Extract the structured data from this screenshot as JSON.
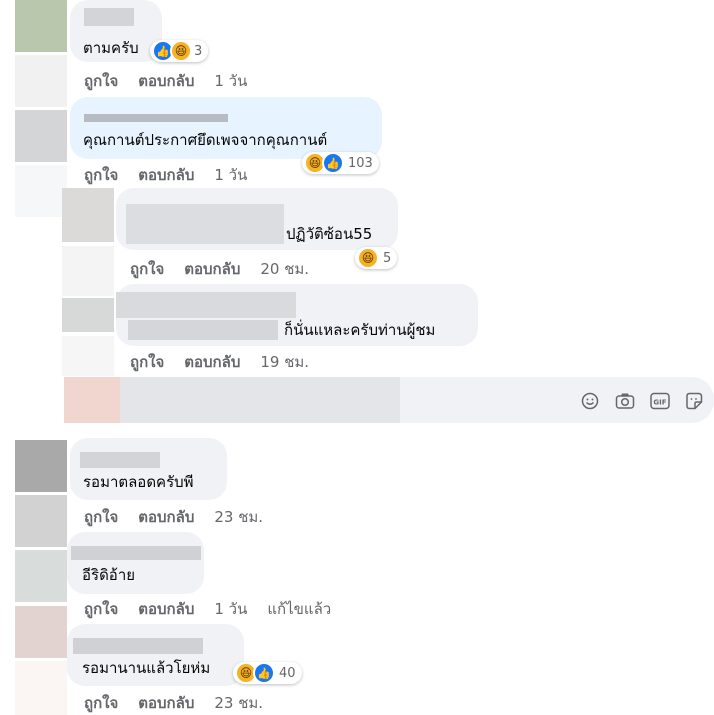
{
  "actions": {
    "like": "ถูกใจ",
    "reply": "ตอบกลับ",
    "edited": "แก้ไขแล้ว"
  },
  "comments": [
    {
      "text": "ตามครับ",
      "reactions": "3",
      "time": "1 วัน"
    },
    {
      "text": "คุณกานต์ประกาศยึดเพจจากคุณกานต์",
      "reactions": "103",
      "time": "1 วัน"
    },
    {
      "text": "ปฏิวัติซ้อน55",
      "reactions": "5",
      "time": "20 ชม."
    },
    {
      "text": "ก็นั่นแหละครับท่านผู้ชม",
      "reactions": "",
      "time": "19 ชม."
    },
    {
      "text": "รอมาตลอดครับพี",
      "reactions": "",
      "time": "23 ชม."
    },
    {
      "text": "อีริดิอ้าย",
      "reactions": "",
      "time": "1 วัน"
    },
    {
      "text": "รอมานานแล้วโยห่ม",
      "reactions": "40",
      "time": "23 ชม."
    }
  ],
  "composer": {
    "icons": [
      "emoji-icon",
      "camera-icon",
      "gif-icon",
      "sticker-icon"
    ],
    "gif_label": "GIF"
  },
  "colors": {
    "bubble": "#f0f2f5",
    "highlight": "#e7f3ff",
    "like": "#1877f2",
    "haha": "#f7b125"
  }
}
